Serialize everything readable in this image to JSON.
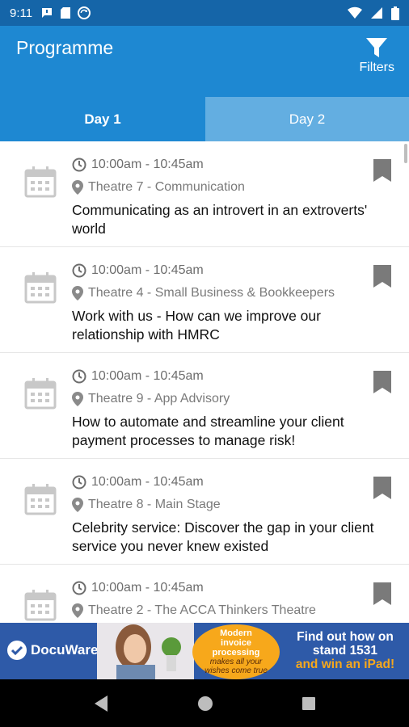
{
  "status_bar": {
    "time": "9:11"
  },
  "app_bar": {
    "title": "Programme",
    "filters_label": "Filters"
  },
  "tabs": [
    {
      "label": "Day 1",
      "active": true
    },
    {
      "label": "Day 2",
      "active": false
    }
  ],
  "sessions": [
    {
      "time": "10:00am - 10:45am",
      "location": "Theatre 7 - Communication",
      "title": "Communicating as an introvert in an extroverts' world"
    },
    {
      "time": "10:00am - 10:45am",
      "location": "Theatre 4 - Small Business & Bookkeepers",
      "title": "Work with us - How can we improve our relationship with HMRC"
    },
    {
      "time": "10:00am - 10:45am",
      "location": "Theatre 9 - App Advisory",
      "title": "How to automate and streamline your client payment processes to manage risk!"
    },
    {
      "time": "10:00am - 10:45am",
      "location": "Theatre 8 - Main Stage",
      "title": "Celebrity service: Discover the gap in your client service you never knew existed"
    },
    {
      "time": "10:00am - 10:45am",
      "location": "Theatre 2 - The ACCA Thinkers Theatre",
      "title": ""
    }
  ],
  "ad": {
    "brand": "DocuWare",
    "circle_line1": "Modern",
    "circle_line2": "invoice",
    "circle_line3": "processing",
    "circle_line4": "makes all your",
    "circle_line5": "wishes come true",
    "cta_line1": "Find out how on",
    "cta_line2": "stand 1531",
    "cta_line3": "and win an iPad!"
  },
  "colors": {
    "status_bar": "#1565a8",
    "app_bar": "#1e88d2",
    "tab_inactive": "#63aee1",
    "ad_bg": "#2e5aa8",
    "ad_accent": "#f7a81b"
  },
  "icons": [
    "message-icon",
    "sd-card-icon",
    "sync-icon",
    "wifi-icon",
    "signal-icon",
    "battery-icon",
    "filter-icon",
    "calendar-icon",
    "clock-icon",
    "location-pin-icon",
    "bookmark-icon",
    "back-icon",
    "home-icon",
    "recents-icon"
  ]
}
